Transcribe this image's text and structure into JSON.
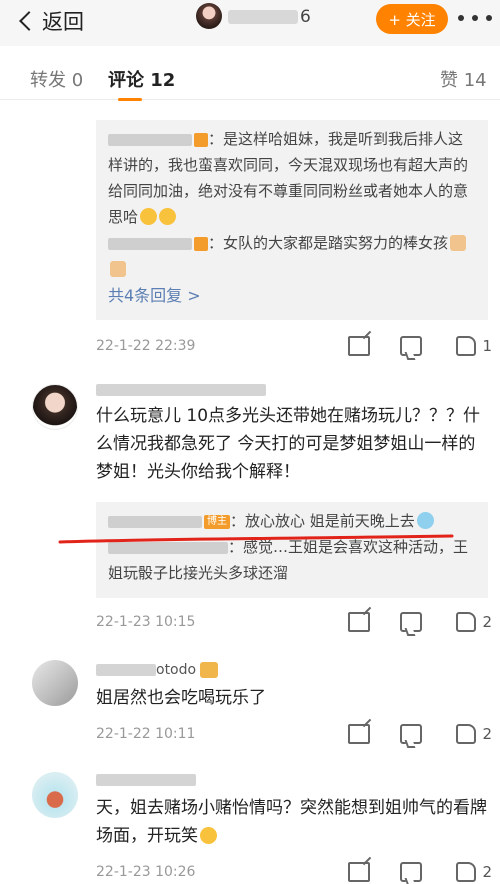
{
  "topbar": {
    "back_label": "返回",
    "username_tail": "6",
    "follow_label": "+ 关注"
  },
  "tabs": {
    "repost": "转发 0",
    "comment": "评论 12",
    "like": "赞 14"
  },
  "comments": [
    {
      "replies": [
        {
          "text": "：是这样哈姐妹，我是听到我后排人这样讲的，我也蛮喜欢同同，今天混双现场也有超大声的给同同加油，绝对没有不尊重同同粉丝或者她本人的意思哈"
        },
        {
          "text": "：女队的大家都是踏实努力的棒女孩"
        }
      ],
      "more_replies": "共4条回复 >",
      "time": "22-1-22 22:39",
      "likes": "1"
    },
    {
      "text": "什么玩意儿 10点多光头还带她在赌场玩儿？？？什么情况我都急死了 今天打的可是梦姐梦姐山一样的梦姐！光头你给我个解释！",
      "replies": [
        {
          "badge": "博主",
          "text": "：放心放心 姐是前天晚上去"
        },
        {
          "text": "：感觉…王姐是会喜欢这种活动，王姐玩骰子比接光头多球还溜"
        }
      ],
      "time": "22-1-23 10:15",
      "likes": "2"
    },
    {
      "name_tail": "otodo",
      "text": "姐居然也会吃喝玩乐了",
      "time": "22-1-22 10:11",
      "likes": "2"
    },
    {
      "text": "天，姐去赌场小赌怡情吗？突然能想到姐帅气的看牌场面，开玩笑",
      "time": "22-1-23 10:26",
      "likes": "2"
    }
  ],
  "colors": {
    "accent": "#ff8200",
    "link": "#5b7fb3",
    "annotation_red": "#e2231a"
  }
}
